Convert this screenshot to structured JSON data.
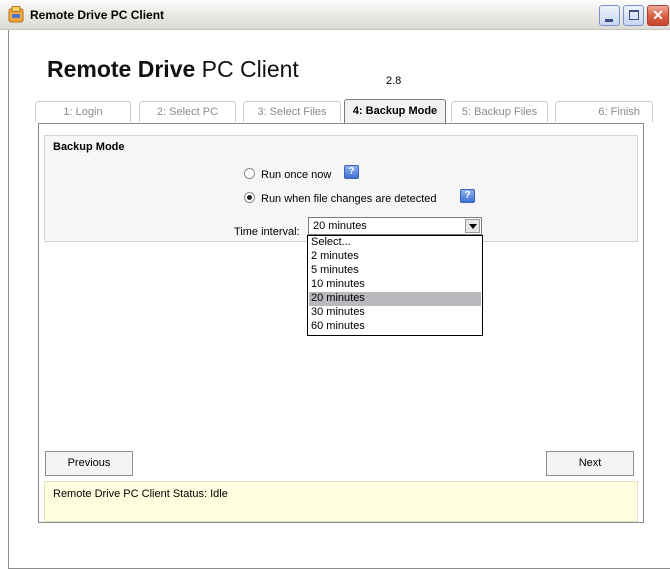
{
  "window": {
    "title": "Remote Drive PC Client"
  },
  "header": {
    "brand_bold": "Remote Drive",
    "brand_rest": " PC Client",
    "version": "2.8"
  },
  "tabs": [
    {
      "label": "1: Login"
    },
    {
      "label": "2: Select PC"
    },
    {
      "label": "3: Select Files"
    },
    {
      "label": "4: Backup Mode"
    },
    {
      "label": "5: Backup Files"
    },
    {
      "label": "6: Finish"
    }
  ],
  "active_tab": "4: Backup Mode",
  "backup_mode": {
    "title": "Backup Mode",
    "option_once": "Run once now",
    "option_changes": "Run when file changes are detected",
    "selected_option": "Run when file changes are detected",
    "time_interval_label": "Time interval:",
    "time_interval_value": "20 minutes",
    "dropdown_options": [
      "Select...",
      "2 minutes",
      "5 minutes",
      "10 minutes",
      "20 minutes",
      "30 minutes",
      "60 minutes"
    ],
    "highlighted_option": "20 minutes"
  },
  "nav": {
    "previous": "Previous",
    "next": "Next"
  },
  "status": {
    "text": "Remote Drive PC Client Status: Idle"
  },
  "colors": {
    "status_bg": "#ffffe0",
    "selection": "#b9b9bd",
    "help_icon": "#3f6fd1"
  },
  "icons": {
    "app": "app-icon",
    "help": "help-icon"
  }
}
